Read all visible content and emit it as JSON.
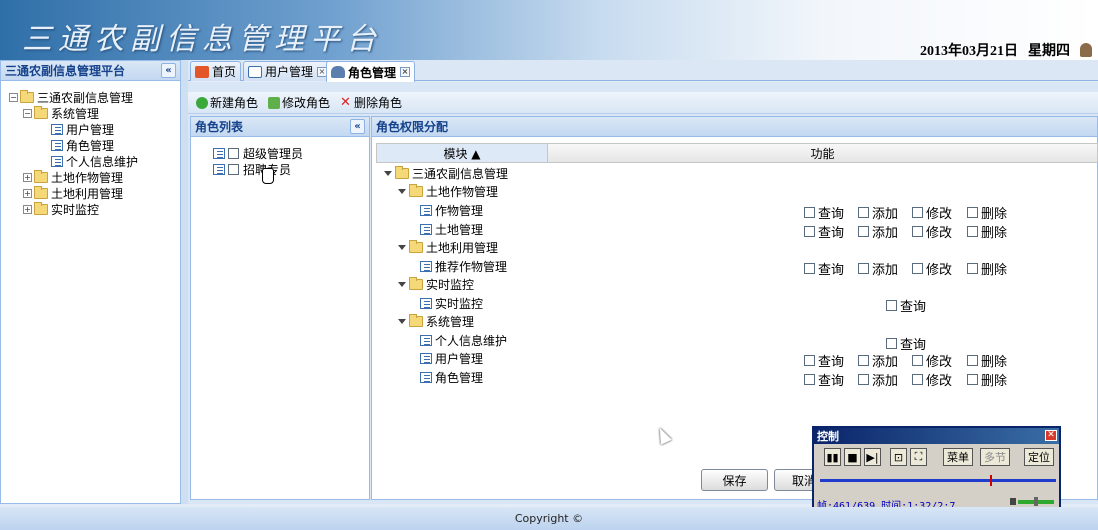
{
  "header": {
    "banner_title": "三通农副信息管理平台",
    "date": "2013年03月21日",
    "weekday": "星期四"
  },
  "left_panel": {
    "title": "三通农副信息管理平台",
    "collapse_glyph": "«",
    "tree": {
      "root": "三通农副信息管理",
      "system_mgmt": "系统管理",
      "user_mgmt": "用户管理",
      "role_mgmt": "角色管理",
      "personal_info": "个人信息维护",
      "land_crop_mgmt": "土地作物管理",
      "land_use_mgmt": "土地利用管理",
      "realtime_monitor": "实时监控"
    }
  },
  "tabs": {
    "home": "首页",
    "user_mgmt": "用户管理",
    "role_mgmt": "角色管理",
    "close_glyph": "×"
  },
  "toolbar": {
    "new_role": "新建角色",
    "edit_role": "修改角色",
    "delete_role": "删除角色"
  },
  "role_list": {
    "title": "角色列表",
    "collapse_glyph": "«",
    "roles": [
      "超级管理员",
      "招聘专员"
    ]
  },
  "permissions": {
    "title": "角色权限分配",
    "col_module": "模块 ▲",
    "col_function": "功能",
    "rows": {
      "root": "三通农副信息管理",
      "land_crop": "土地作物管理",
      "crop_mgmt": "作物管理",
      "land_mgmt": "土地管理",
      "land_use": "土地利用管理",
      "recommend_crop": "推荐作物管理",
      "realtime": "实时监控",
      "realtime_leaf": "实时监控",
      "system": "系统管理",
      "personal_info": "个人信息维护",
      "user_mgmt": "用户管理",
      "role_mgmt": "角色管理"
    },
    "ops": {
      "query": "查询",
      "add": "添加",
      "edit": "修改",
      "delete": "删除"
    }
  },
  "buttons": {
    "save": "保存",
    "cancel": "取消"
  },
  "control_window": {
    "title": "控制",
    "menu": "菜单",
    "multi": "多节",
    "locate": "定位",
    "status": "帧:461/639 时间:1:32/2:7",
    "progress": 0.72,
    "volume": 0.5
  },
  "footer": {
    "copyright": "Copyright ©"
  },
  "colors": {
    "panel_border": "#99bbe8",
    "panel_title": "#15428b",
    "header_gradient_start": "#2f6fa8",
    "control_title": "#0a246a"
  }
}
